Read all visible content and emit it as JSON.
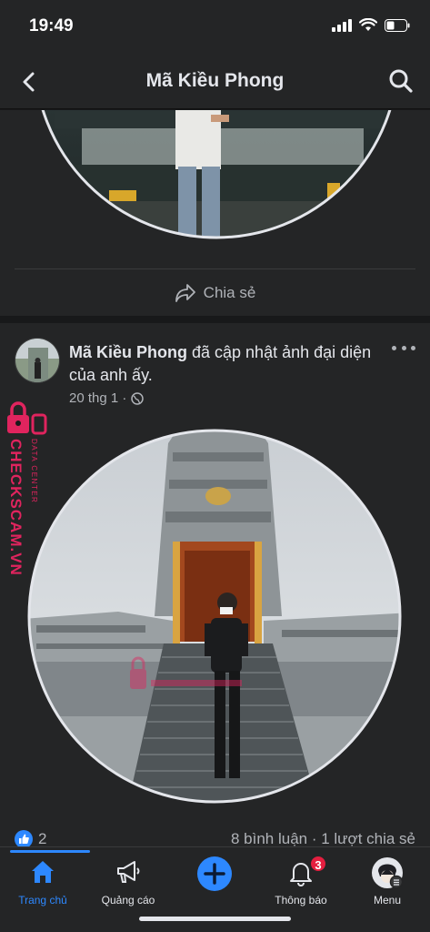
{
  "status_bar": {
    "time": "19:49"
  },
  "nav": {
    "title": "Mã Kiều Phong"
  },
  "previous_post": {
    "share_label": "Chia sẻ"
  },
  "post": {
    "author": "Mã Kiều Phong",
    "action_text": " đã cập nhật ảnh đại diện của anh ấy.",
    "date": "20 thg 1 ·",
    "like_count": "2",
    "comments_shares": "8 bình luận · 1 lượt chia sẻ"
  },
  "watermark": {
    "text": "CHECKSCAM.VN",
    "subtext": "DATA CENTER"
  },
  "tabs": [
    {
      "label": "Trang chủ",
      "icon": "home-icon",
      "active": true
    },
    {
      "label": "Quảng cáo",
      "icon": "megaphone-icon"
    },
    {
      "label": "",
      "icon": "plus-icon"
    },
    {
      "label": "Thông báo",
      "icon": "bell-icon",
      "badge": "3"
    },
    {
      "label": "Menu",
      "icon": "profile-icon"
    }
  ],
  "colors": {
    "accent": "#2d88ff",
    "badge": "#e41e3f",
    "background": "#18191a",
    "card": "#242526",
    "watermark": "#e0245e"
  }
}
